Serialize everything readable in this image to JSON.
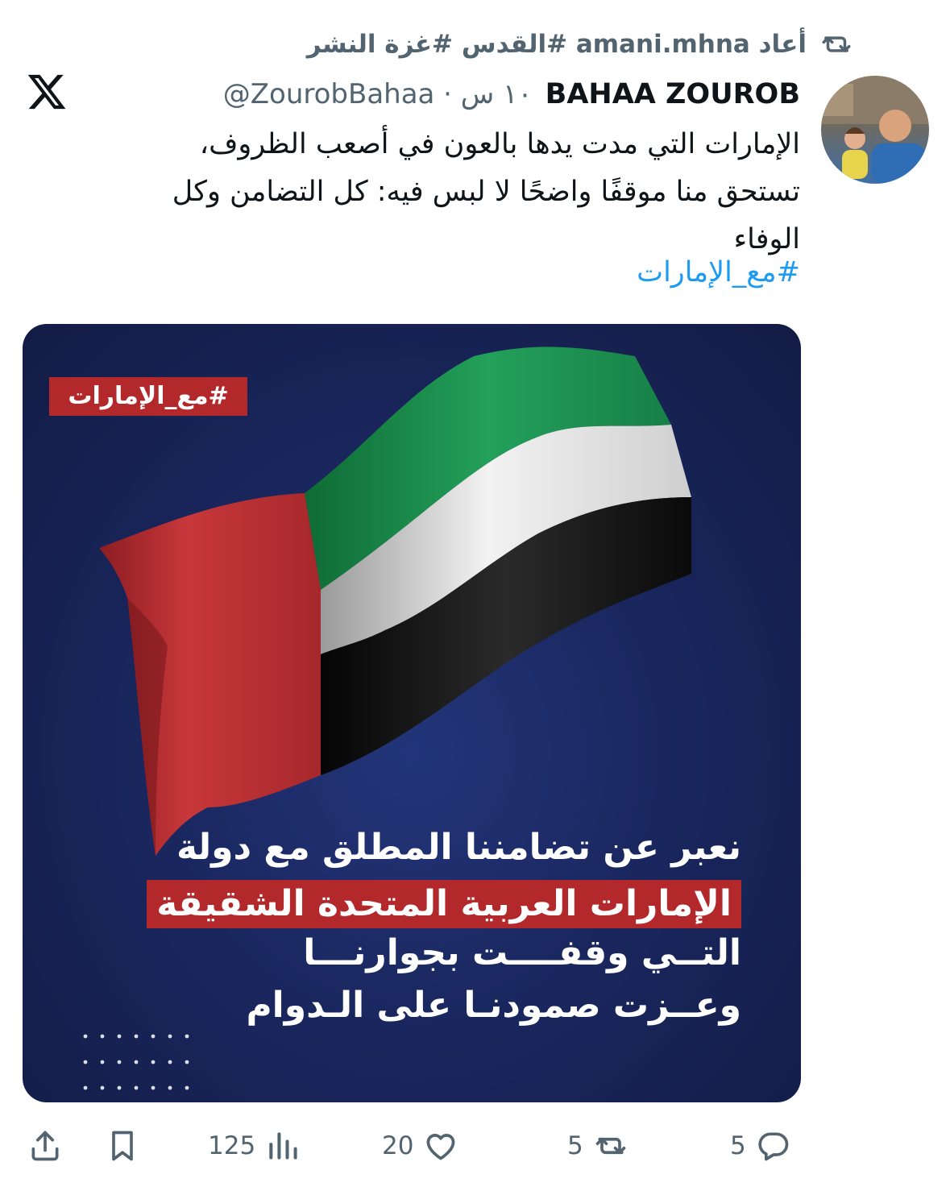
{
  "retweet": {
    "text": "أعاد amani.mhna #القدس #غزة النشر",
    "icon": "retweet-icon"
  },
  "author": {
    "name": "BAHAA ZOUROB",
    "handle_time": "@ZourobBahaa · ١٠ س"
  },
  "tweet": {
    "lines": [
      "الإمارات التي مدت يدها بالعون في أصعب الظروف،",
      "تستحق منا موقفًا واضحًا لا لبس فيه: كل التضامن وكل",
      "الوفاء"
    ],
    "hashtag": "#مع_الإمارات"
  },
  "media": {
    "tag": "#مع_الإمارات",
    "line1": "نعبر عن تضامننا المطلق مع  دولة",
    "line2": "الإمارات العربية المتحدة الشقيقة",
    "line3": "التــي وقفــــت بجوارنـــا",
    "line4": "وعــزت صمودنـا على الـدوام",
    "colors": {
      "red": "#b3282b",
      "green": "#1e8a4c",
      "white": "#e6e6e6",
      "black": "#111111",
      "bg": "#1a275f"
    }
  },
  "actions": {
    "replies": "5",
    "retweets": "5",
    "likes": "20",
    "views": "125"
  }
}
